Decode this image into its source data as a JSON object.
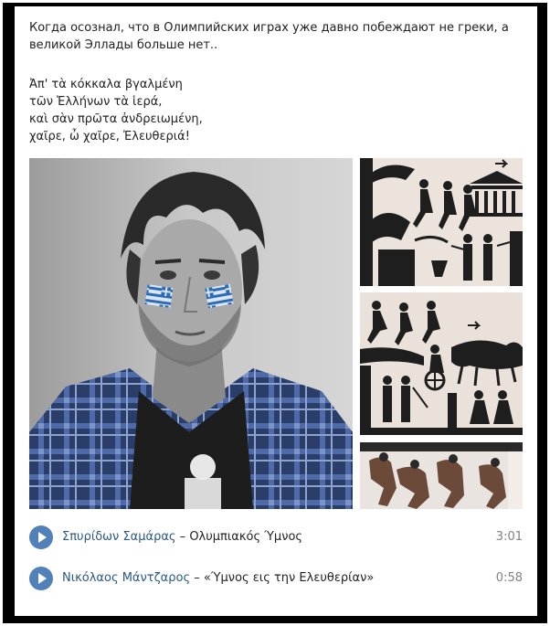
{
  "post": {
    "text": "Когда осознал, что в Олимпийских играх уже давно побеждают не греки, а\nвеликой Эллады больше нет..",
    "poem": [
      "Ἀπ' τὰ κόκκαλα βγαλμένη",
      "τῶν Ἑλλήνων τὰ ἱερά,",
      "καὶ σὰν πρῶτα ἀνδρειωμένη,",
      "χαῖρε, ὦ χαῖρε, Ἐλευθεριά!"
    ]
  },
  "audio": [
    {
      "artist": "Σπυρίδων Σαμάρας",
      "separator": "–",
      "title": "Ολυμπιακός Ύμνος",
      "duration": "3:01"
    },
    {
      "artist": "Νικόλαος Μάντζαρος",
      "separator": "–",
      "title": "«Ύμνος εις την Ελευθερίαν»",
      "duration": "0:58"
    }
  ],
  "icons": {
    "play": "play-icon"
  },
  "colors": {
    "link": "#2a5885",
    "play_button": "#5181b8",
    "duration": "#828282",
    "text": "#222222",
    "flag_blue": "#2e6bb5"
  }
}
